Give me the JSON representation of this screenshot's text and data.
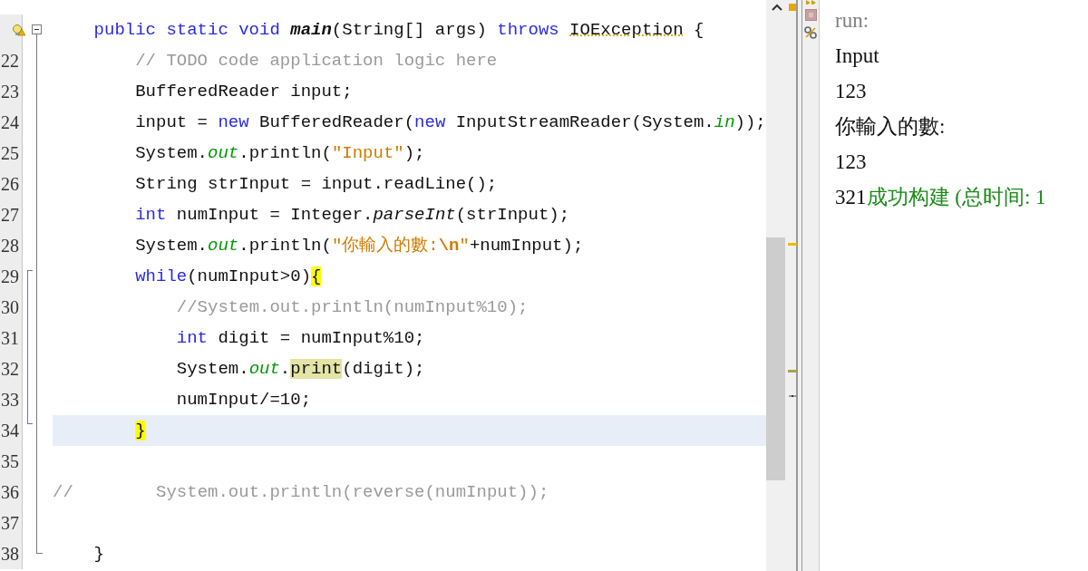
{
  "editor": {
    "lines": [
      {
        "kind": "block",
        "hint": true,
        "current": false,
        "expanded": true,
        "tokens": [
          {
            "kind": "keyword",
            "text": "public static void "
          },
          {
            "kind": "decl",
            "text": "main"
          },
          {
            "kind": "plain",
            "text": "(String[] args) "
          },
          {
            "kind": "keyword",
            "text": "throws "
          },
          {
            "kind": "warn",
            "text": "IOException"
          },
          {
            "kind": "plain",
            "text": " {"
          }
        ],
        "children": [
          {
            "kind": "code",
            "number": "22",
            "hint": false,
            "current": false,
            "tokens": [
              {
                "kind": "comment",
                "text": "// TODO code application logic here"
              }
            ]
          },
          {
            "kind": "code",
            "number": "23",
            "hint": false,
            "current": false,
            "tokens": [
              {
                "kind": "plain",
                "text": "BufferedReader input;"
              }
            ]
          },
          {
            "kind": "code",
            "number": "24",
            "hint": false,
            "current": false,
            "tokens": [
              {
                "kind": "plain",
                "text": "input = "
              },
              {
                "kind": "keyword",
                "text": "new"
              },
              {
                "kind": "plain",
                "text": " BufferedReader("
              },
              {
                "kind": "keyword",
                "text": "new"
              },
              {
                "kind": "plain",
                "text": " InputStreamReader(System."
              },
              {
                "kind": "field",
                "text": "in"
              },
              {
                "kind": "plain",
                "text": "));"
              }
            ]
          },
          {
            "kind": "code",
            "number": "25",
            "hint": false,
            "current": false,
            "tokens": [
              {
                "kind": "plain",
                "text": "System."
              },
              {
                "kind": "field",
                "text": "out"
              },
              {
                "kind": "plain",
                "text": ".println("
              },
              {
                "kind": "string",
                "text": "\"Input\""
              },
              {
                "kind": "plain",
                "text": ");"
              }
            ]
          },
          {
            "kind": "code",
            "number": "26",
            "hint": false,
            "current": false,
            "tokens": [
              {
                "kind": "plain",
                "text": "String strInput = input.readLine();"
              }
            ]
          },
          {
            "kind": "code",
            "number": "27",
            "hint": false,
            "current": false,
            "tokens": [
              {
                "kind": "keyword",
                "text": "int"
              },
              {
                "kind": "plain",
                "text": " numInput = Integer."
              },
              {
                "kind": "static",
                "text": "parseInt"
              },
              {
                "kind": "plain",
                "text": "(strInput);"
              }
            ]
          },
          {
            "kind": "code",
            "number": "28",
            "hint": false,
            "current": false,
            "tokens": [
              {
                "kind": "plain",
                "text": "System."
              },
              {
                "kind": "field",
                "text": "out"
              },
              {
                "kind": "plain",
                "text": ".println("
              },
              {
                "kind": "string",
                "text": "\"你輸入的數:"
              },
              {
                "kind": "escape",
                "text": "\\n"
              },
              {
                "kind": "string",
                "text": "\""
              },
              {
                "kind": "plain",
                "text": "+numInput);"
              }
            ]
          },
          {
            "kind": "block",
            "number": "29",
            "hint": false,
            "current": false,
            "expanded": true,
            "tokens": [
              {
                "kind": "keyword",
                "text": "while"
              },
              {
                "kind": "plain",
                "text": "(numInput>0)"
              },
              {
                "kind": "brace",
                "text": "{"
              }
            ],
            "children": [
              {
                "kind": "code",
                "number": "30",
                "hint": false,
                "current": false,
                "tokens": [
                  {
                    "kind": "comment",
                    "text": "//System.out.println(numInput%10);"
                  }
                ]
              },
              {
                "kind": "code",
                "number": "31",
                "hint": false,
                "current": false,
                "tokens": [
                  {
                    "kind": "keyword",
                    "text": "int"
                  },
                  {
                    "kind": "plain",
                    "text": " digit = numInput%10;"
                  }
                ]
              },
              {
                "kind": "code",
                "number": "32",
                "hint": false,
                "current": false,
                "tokens": [
                  {
                    "kind": "plain",
                    "text": "System."
                  },
                  {
                    "kind": "field",
                    "text": "out"
                  },
                  {
                    "kind": "plain",
                    "text": "."
                  },
                  {
                    "kind": "occurrence",
                    "text": "print"
                  },
                  {
                    "kind": "plain",
                    "text": "(digit);"
                  }
                ]
              },
              {
                "kind": "code",
                "number": "33",
                "hint": false,
                "current": false,
                "tokens": [
                  {
                    "kind": "plain",
                    "text": "numInput/=10;"
                  }
                ]
              }
            ],
            "closing": {
              "number": "34",
              "hint": false,
              "current": true,
              "tokens": [
                {
                  "kind": "brace",
                  "text": "}"
                }
              ]
            }
          },
          {
            "kind": "code",
            "number": "35",
            "hint": false,
            "current": false
          },
          {
            "kind": "commented-out",
            "number": "36",
            "hint": false,
            "current": false,
            "tokens": [
              {
                "kind": "comment",
                "text": "//        System.out.println(reverse(numInput));"
              }
            ]
          },
          {
            "kind": "code",
            "number": "37",
            "hint": false,
            "current": false
          }
        ],
        "closing": {
          "number": "38",
          "hint": false,
          "current": false,
          "tokens": [
            {
              "kind": "plain",
              "text": "}"
            }
          ]
        }
      }
    ]
  },
  "output": {
    "lines": [
      [
        {
          "kind": "info",
          "text": "run:"
        }
      ],
      [
        {
          "kind": "stdout",
          "text": "Input"
        }
      ],
      [
        {
          "kind": "stdout",
          "text": "123"
        }
      ],
      [
        {
          "kind": "stdout",
          "text": "你輸入的數:"
        }
      ],
      [
        {
          "kind": "stdout",
          "text": "123"
        }
      ],
      [
        {
          "kind": "stdout",
          "text": "321"
        },
        {
          "kind": "success",
          "text": "成功构建 (总时间: 1"
        }
      ]
    ]
  }
}
